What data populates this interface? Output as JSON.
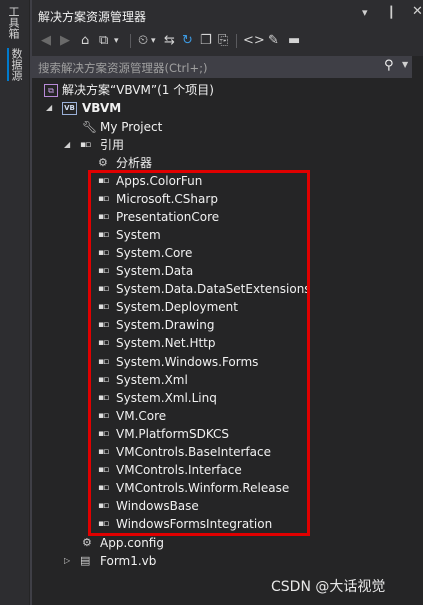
{
  "side_tabs": {
    "toolbox": "工具箱",
    "datasource": "数据源"
  },
  "window": {
    "title": "解决方案资源管理器"
  },
  "search": {
    "placeholder": "搜索解决方案资源管理器(Ctrl+;)"
  },
  "tree": {
    "solution": "解决方案“VBVM”(1 个项目)",
    "project": "VBVM",
    "my_project": "My Project",
    "references": "引用",
    "analyzers": "分析器",
    "refs": [
      "Apps.ColorFun",
      "Microsoft.CSharp",
      "PresentationCore",
      "System",
      "System.Core",
      "System.Data",
      "System.Data.DataSetExtensions",
      "System.Deployment",
      "System.Drawing",
      "System.Net.Http",
      "System.Windows.Forms",
      "System.Xml",
      "System.Xml.Linq",
      "VM.Core",
      "VM.PlatformSDKCS",
      "VMControls.BaseInterface",
      "VMControls.Interface",
      "VMControls.Winform.Release",
      "WindowsBase",
      "WindowsFormsIntegration"
    ],
    "app_config": "App.config",
    "form1": "Form1.vb"
  },
  "watermark": "CSDN @大话视觉",
  "colors": {
    "highlight": "#e00000",
    "accent": "#007acc"
  }
}
